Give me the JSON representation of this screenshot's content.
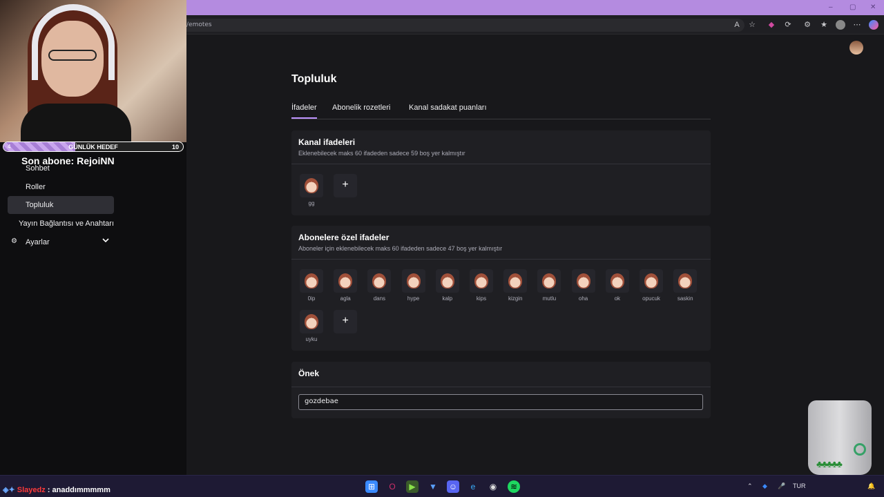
{
  "browser": {
    "url": "/emotes",
    "window_controls": [
      "–",
      "▢",
      "✕"
    ]
  },
  "stream_overlay": {
    "goal_label": "GÜNLÜK HEDEF",
    "goal_current": "4",
    "goal_target": "10",
    "goal_progress": 0.4,
    "last_sub": "Son abone: RejoiNN"
  },
  "sidebar": {
    "items": [
      {
        "label": "Sohbet"
      },
      {
        "label": "Roller"
      },
      {
        "label": "Topluluk"
      },
      {
        "label": "Yayın Bağlantısı ve Anahtarı"
      },
      {
        "label": "Ayarlar"
      }
    ]
  },
  "main": {
    "title": "Topluluk",
    "tabs": [
      {
        "label": "İfadeler"
      },
      {
        "label": "Abonelik rozetleri"
      },
      {
        "label": "Kanal sadakat puanları"
      }
    ],
    "channel_emotes": {
      "title": "Kanal ifadeleri",
      "subtitle": "Eklenebilecek maks 60 ifadeden sadece 59 boş yer kalmıştır",
      "emotes": [
        "gg"
      ]
    },
    "sub_emotes": {
      "title": "Abonelere özel ifadeler",
      "subtitle": "Aboneler için eklenebilecek maks 60 ifadeden sadece 47 boş yer kalmıştır",
      "emotes": [
        "0ip",
        "agla",
        "dans",
        "hype",
        "kalp",
        "kips",
        "kizgin",
        "mutlu",
        "oha",
        "ok",
        "opucuk",
        "saskin",
        "uyku"
      ]
    },
    "prefix": {
      "title": "Önek",
      "value": "gozdebae"
    },
    "add_symbol": "+"
  },
  "taskbar": {
    "chat_user": "Slayedz",
    "chat_message": ": anaddımmmmm",
    "language": "TUR"
  },
  "colors": {
    "accent": "#bf94ff",
    "card": "#1f1f23",
    "background": "#18181b"
  }
}
